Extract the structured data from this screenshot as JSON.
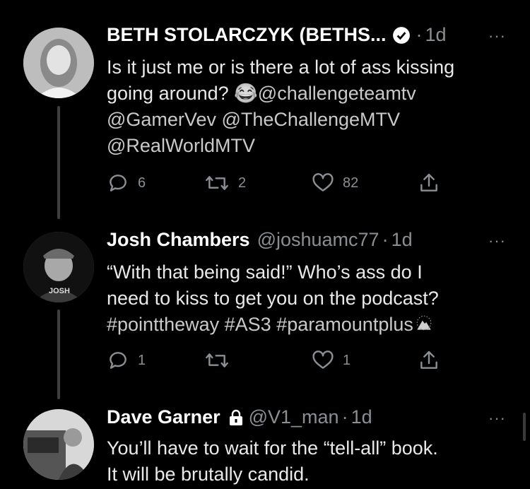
{
  "tweets": [
    {
      "name": "BETH STOLARCZYK (BETHS...",
      "handle": "",
      "dot": "·",
      "time": "1d",
      "text_line1": "Is it just me or is there a lot of ass kissing",
      "text_line2a": "going around? ",
      "emoji": "😂",
      "mention1": "@challengeteamtv",
      "mention2": "@GamerVev",
      "mention3": "@TheChallengeMTV",
      "mention4": "@RealWorldMTV",
      "replies": "6",
      "retweets": "2",
      "likes": "82"
    },
    {
      "name": "Josh Chambers",
      "handle": "@joshuamc77",
      "dot": "·",
      "time": "1d",
      "avatar_label": "JOSH",
      "text_line1": "“With that being said!” Who’s ass do I",
      "text_line2": "need to kiss to get you on the podcast?",
      "tag1": "#pointtheway",
      "tag2": "#AS3",
      "tag3": "#paramountplus",
      "replies": "1",
      "retweets": "",
      "likes": "1"
    },
    {
      "name": "Dave Garner",
      "handle": "@V1_man",
      "dot": "·",
      "time": "1d",
      "text_line1": "You’ll have to wait for the “tell-all” book.",
      "text_line2": "It will be brutally candid."
    }
  ],
  "more_glyph": "···",
  "colors": {
    "background": "#000000",
    "text": "#e7e9ea",
    "muted": "#8b8f93",
    "thread": "#3e3e3e"
  }
}
